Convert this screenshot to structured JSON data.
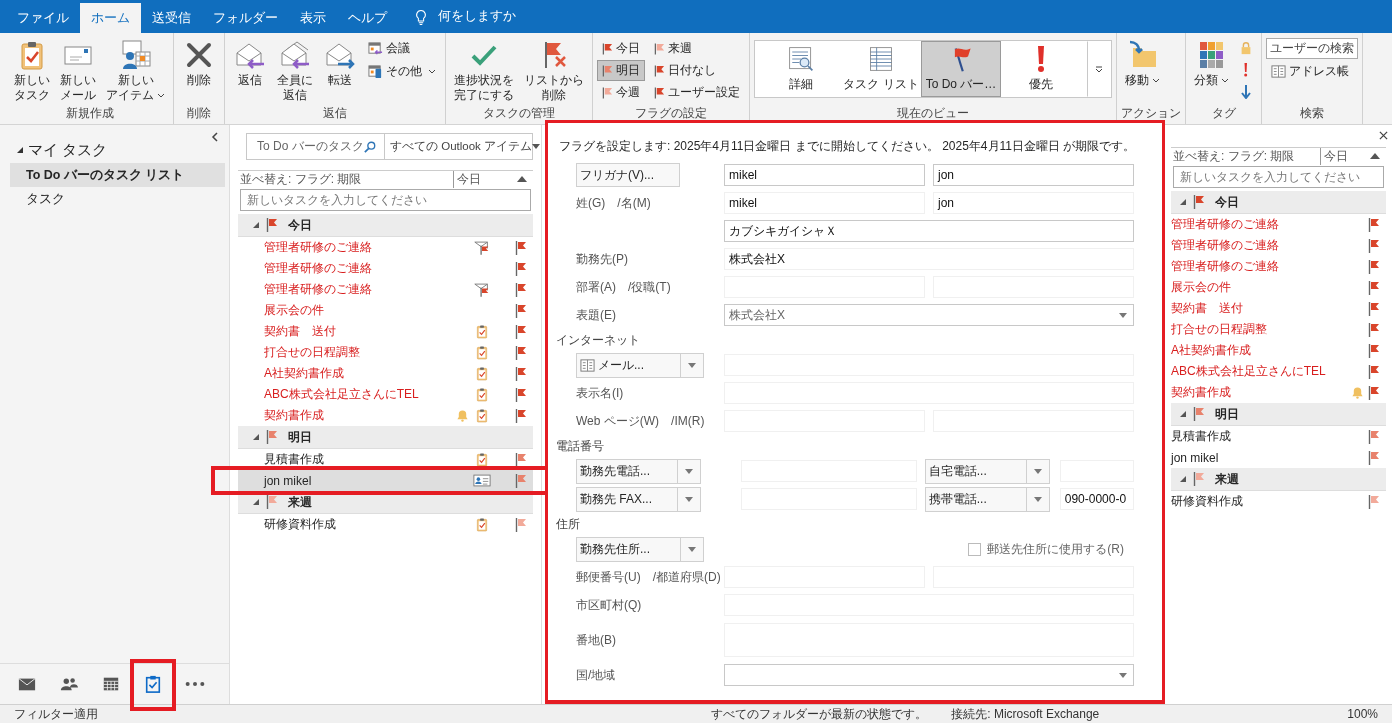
{
  "ribbon_tabs": [
    {
      "label": "ファイル",
      "selected": false
    },
    {
      "label": "ホーム",
      "selected": true
    },
    {
      "label": "送受信",
      "selected": false
    },
    {
      "label": "フォルダー",
      "selected": false
    },
    {
      "label": "表示",
      "selected": false
    },
    {
      "label": "ヘルプ",
      "selected": false
    }
  ],
  "tell_me": "何をしますか",
  "ribbon_groups": [
    {
      "kind": "buttons",
      "label": "新規作成",
      "large": [
        {
          "label": "新しいタスク",
          "dropdown": false
        },
        {
          "label": "新しいメール",
          "dropdown": false
        },
        {
          "label": "新しいアイテム",
          "dropdown": true
        }
      ]
    },
    {
      "kind": "buttons",
      "label": "削除",
      "large": [
        {
          "label": "削除",
          "dropdown": false
        }
      ]
    },
    {
      "kind": "buttons",
      "label": "返信",
      "large": [
        {
          "label": "返信",
          "dropdown": false
        },
        {
          "label": "全員に返信",
          "dropdown": false
        },
        {
          "label": "転送",
          "dropdown": false
        }
      ],
      "small": [
        {
          "label": "会議",
          "dropdown": false
        },
        {
          "label": "その他",
          "dropdown": true
        }
      ]
    },
    {
      "kind": "buttons",
      "label": "タスクの管理",
      "large": [
        {
          "label": "進捗状況を完了にする",
          "dropdown": false
        },
        {
          "label": "リストから削除",
          "dropdown": false
        }
      ]
    },
    {
      "kind": "flags",
      "label": "フラグの設定",
      "flags": [
        {
          "label": "今日",
          "color": "#d9452b",
          "selected": false
        },
        {
          "label": "来週",
          "color": "#f2aa9a",
          "selected": false
        },
        {
          "label": "明日",
          "color": "#e8826c",
          "selected": true
        },
        {
          "label": "日付なし",
          "color": "#d9452b",
          "selected": false
        },
        {
          "label": "今週",
          "color": "#f2aa9a",
          "selected": false
        },
        {
          "label": "ユーザー設定",
          "color": "#d9452b",
          "selected": false
        }
      ]
    },
    {
      "kind": "views",
      "label": "現在のビュー",
      "views": [
        {
          "label": "詳細",
          "selected": false
        },
        {
          "label": "タスク リスト",
          "selected": false
        },
        {
          "label": "To Do バー…",
          "selected": true
        },
        {
          "label": "優先",
          "selected": false
        }
      ]
    },
    {
      "kind": "buttons",
      "label": "アクション",
      "large": [
        {
          "label": "移動",
          "dropdown": true
        }
      ]
    },
    {
      "kind": "tags",
      "label": "タグ",
      "large": [
        {
          "label": "分類",
          "dropdown": true
        }
      ]
    },
    {
      "kind": "search",
      "label": "検索",
      "search": {
        "placeholder": "ユーザーの検索"
      },
      "small": [
        {
          "label": "アドレス帳",
          "dropdown": false
        }
      ]
    }
  ],
  "folder_pane": {
    "heading": "マイ タスク",
    "expanded": true,
    "items": [
      {
        "label": "To Do バーのタスク リスト",
        "selected": true
      },
      {
        "label": "タスク",
        "selected": false
      }
    ]
  },
  "nav": [
    {
      "selected": false,
      "highlighted": false
    },
    {
      "selected": false,
      "highlighted": false
    },
    {
      "selected": false,
      "highlighted": false
    },
    {
      "selected": true,
      "highlighted": true
    },
    {
      "selected": false,
      "highlighted": false
    }
  ],
  "task_list": {
    "search_placeholder": "To Do バーのタスク",
    "scope": "すべての Outlook アイテム",
    "sort_label": "並べ替え: フラグ: 期限",
    "sort_value": "今日",
    "new_task_placeholder": "新しいタスクを入力してください",
    "groups": [
      {
        "label": "今日",
        "color": "#d9452b",
        "expanded": true,
        "items": [
          {
            "title": "管理者研修のご連絡",
            "overdue": true,
            "kind": "mail",
            "reminder": false,
            "selected": false,
            "highlighted": false
          },
          {
            "title": "管理者研修のご連絡",
            "overdue": true,
            "kind": "plain",
            "reminder": false,
            "selected": false,
            "highlighted": false
          },
          {
            "title": "管理者研修のご連絡",
            "overdue": true,
            "kind": "mail",
            "reminder": false,
            "selected": false,
            "highlighted": false
          },
          {
            "title": "展示会の件",
            "overdue": true,
            "kind": "plain",
            "reminder": false,
            "selected": false,
            "highlighted": false
          },
          {
            "title": "契約書　送付",
            "overdue": true,
            "kind": "task",
            "reminder": false,
            "selected": false,
            "highlighted": false
          },
          {
            "title": "打合せの日程調整",
            "overdue": true,
            "kind": "task",
            "reminder": false,
            "selected": false,
            "highlighted": false
          },
          {
            "title": "A社契約書作成",
            "overdue": true,
            "kind": "task",
            "reminder": false,
            "selected": false,
            "highlighted": false
          },
          {
            "title": "ABC株式会社足立さんにTEL",
            "overdue": true,
            "kind": "task",
            "reminder": false,
            "selected": false,
            "highlighted": false
          },
          {
            "title": "契約書作成",
            "overdue": true,
            "kind": "task",
            "reminder": true,
            "selected": false,
            "highlighted": false
          }
        ]
      },
      {
        "label": "明日",
        "color": "#e8826c",
        "expanded": true,
        "items": [
          {
            "title": "見積書作成",
            "overdue": false,
            "kind": "task",
            "reminder": false,
            "selected": false,
            "highlighted": false
          },
          {
            "title": "jon mikel",
            "overdue": false,
            "kind": "contact",
            "reminder": false,
            "selected": true,
            "highlighted": true
          }
        ]
      },
      {
        "label": "来週",
        "color": "#f2aa9a",
        "expanded": true,
        "items": [
          {
            "title": "研修資料作成",
            "overdue": false,
            "kind": "task",
            "reminder": false,
            "selected": false,
            "highlighted": false
          }
        ]
      }
    ]
  },
  "form": {
    "info": "フラグを設定します:  2025年4月11日金曜日 までに開始してください。  2025年4月11日金曜日 が期限です。",
    "rows": [
      {
        "kind": "furigana",
        "button": "フリガナ(V)...",
        "values": [
          "mikel",
          "jon"
        ]
      },
      {
        "kind": "pair",
        "label": "姓(G)　/名(M)",
        "values": [
          "mikel",
          "jon"
        ]
      },
      {
        "kind": "outlined",
        "value": "カブシキガイシャＸ"
      },
      {
        "kind": "single",
        "label": "勤務先(P)",
        "value": "株式会社X"
      },
      {
        "kind": "pair",
        "label": "部署(A)　/役職(T)"
      },
      {
        "kind": "select",
        "label": "表題(E)",
        "value": "株式会社X"
      },
      {
        "kind": "section",
        "label": "インターネット"
      },
      {
        "kind": "picker",
        "picker": {
          "label": "メール..."
        }
      },
      {
        "kind": "single",
        "label": "表示名(I)"
      },
      {
        "kind": "pair",
        "label": "Web ページ(W)　/IM(R)"
      },
      {
        "kind": "section",
        "label": "電話番号"
      },
      {
        "kind": "phone",
        "pickers": [
          {
            "label": "勤務先電話..."
          },
          {
            "label": "自宅電話..."
          }
        ]
      },
      {
        "kind": "phone",
        "pickers": [
          {
            "label": "勤務先 FAX..."
          },
          {
            "label": "携帯電話...",
            "value": "090-0000-0"
          }
        ]
      },
      {
        "kind": "section",
        "label": "住所"
      },
      {
        "kind": "address",
        "picker": {
          "label": "勤務先住所..."
        },
        "checkbox": {
          "label": "郵送先住所に使用する(R)",
          "checked": false
        }
      },
      {
        "kind": "pair",
        "label": "郵便番号(U)　/都道府県(D)"
      },
      {
        "kind": "single",
        "label": "市区町村(Q)"
      },
      {
        "kind": "multiline",
        "label": "番地(B)"
      },
      {
        "kind": "select",
        "label": "国/地域"
      }
    ]
  },
  "todo_bar": {
    "sort_label": "並べ替え: フラグ: 期限",
    "sort_value": "今日",
    "new_task_placeholder": "新しいタスクを入力してください",
    "groups": [
      {
        "label": "今日",
        "color": "#d9452b",
        "expanded": true,
        "items": [
          {
            "title": "管理者研修のご連絡",
            "overdue": true,
            "reminder": false
          },
          {
            "title": "管理者研修のご連絡",
            "overdue": true,
            "reminder": false
          },
          {
            "title": "管理者研修のご連絡",
            "overdue": true,
            "reminder": false
          },
          {
            "title": "展示会の件",
            "overdue": true,
            "reminder": false
          },
          {
            "title": "契約書　送付",
            "overdue": true,
            "reminder": false
          },
          {
            "title": "打合せの日程調整",
            "overdue": true,
            "reminder": false
          },
          {
            "title": "A社契約書作成",
            "overdue": true,
            "reminder": false
          },
          {
            "title": "ABC株式会社足立さんにTEL",
            "overdue": true,
            "reminder": false
          },
          {
            "title": "契約書作成",
            "overdue": true,
            "reminder": true
          }
        ]
      },
      {
        "label": "明日",
        "color": "#e8826c",
        "expanded": true,
        "items": [
          {
            "title": "見積書作成",
            "overdue": false,
            "reminder": false
          },
          {
            "title": "jon mikel",
            "overdue": false,
            "reminder": false
          }
        ]
      },
      {
        "label": "来週",
        "color": "#f2aa9a",
        "expanded": true,
        "items": [
          {
            "title": "研修資料作成",
            "overdue": false,
            "reminder": false
          }
        ]
      }
    ]
  },
  "status_bar": {
    "filter": "フィルター適用",
    "sync": "すべてのフォルダーが最新の状態です。",
    "connection": "接続先: Microsoft Exchange",
    "zoom": "100%"
  }
}
